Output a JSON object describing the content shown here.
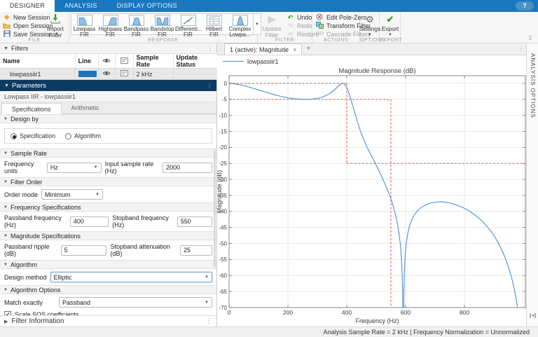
{
  "ribbon": {
    "tabs": [
      {
        "label": "DESIGNER",
        "active": true
      },
      {
        "label": "ANALYSIS",
        "active": false
      },
      {
        "label": "DISPLAY OPTIONS",
        "active": false
      }
    ],
    "help_label": "?",
    "file": {
      "section": "FILE",
      "new": "New Session",
      "open": "Open Session",
      "save": "Save Session",
      "import_line1": "Import",
      "import_line2": "Filter"
    },
    "response": {
      "section": "RESPONSE",
      "items": [
        {
          "line1": "Lowpass",
          "line2": "FIR",
          "icon": "lowpass-fir-icon"
        },
        {
          "line1": "Highpass",
          "line2": "FIR",
          "icon": "highpass-fir-icon"
        },
        {
          "line1": "Bandpass",
          "line2": "FIR",
          "icon": "bandpass-fir-icon"
        },
        {
          "line1": "Bandstop",
          "line2": "FIR",
          "icon": "bandstop-fir-icon"
        },
        {
          "line1": "Differenti...",
          "line2": "FIR",
          "icon": "differentiator-fir-icon"
        },
        {
          "line1": "Hilbert FIR",
          "line2": "",
          "icon": "hilbert-fir-icon"
        },
        {
          "line1": "Complex",
          "line2": "Lowpa...",
          "icon": "complex-lowpass-icon"
        }
      ]
    },
    "filter": {
      "section": "FILTER",
      "update_line1": "Update",
      "update_line2": "Filter",
      "undo": "Undo",
      "redo": "Redo",
      "restore": "Restore"
    },
    "actions": {
      "section": "ACTIONS",
      "items": [
        {
          "label": "Edit Pole-Zero",
          "enabled": true,
          "icon": "pole-zero-icon"
        },
        {
          "label": "Transform Filter",
          "enabled": true,
          "icon": "transform-filter-icon"
        },
        {
          "label": "Cascade Filters",
          "enabled": false,
          "icon": "cascade-filters-icon"
        }
      ]
    },
    "options": {
      "section": "OPTIONS",
      "settings": "Settings"
    },
    "export": {
      "section": "EXPORT",
      "export": "Export"
    }
  },
  "filters_panel": {
    "title": "Filters",
    "columns": [
      "Name",
      "Line",
      "eye",
      "info",
      "Sample Rate",
      "Update Status"
    ],
    "rows": [
      {
        "name": "lowpassiir1",
        "line_color": "#1b75bc",
        "visible": true,
        "sample_rate": "2 kHz",
        "update_status": ""
      }
    ]
  },
  "parameters_panel": {
    "title": "Parameters",
    "subtitle": "Lowpass IIR - lowpassiir1",
    "tabs": [
      {
        "label": "Specifications",
        "active": true
      },
      {
        "label": "Arithmetic",
        "active": false
      }
    ],
    "design_by": {
      "title": "Design by",
      "options": [
        {
          "label": "Specification",
          "selected": true
        },
        {
          "label": "Algorithm",
          "selected": false
        }
      ]
    },
    "sample_rate": {
      "title": "Sample Rate",
      "frequency_units_label": "Frequency units",
      "frequency_units_value": "Hz",
      "input_rate_label": "Input sample rate (Hz)",
      "input_rate_value": "2000"
    },
    "filter_order": {
      "title": "Filter Order",
      "order_mode_label": "Order mode",
      "order_mode_value": "Minimum"
    },
    "frequency_specifications": {
      "title": "Frequency Specifications",
      "passband_label": "Passband frequency (Hz)",
      "passband_value": "400",
      "stopband_label": "Stopband frequency (Hz)",
      "stopband_value": "550"
    },
    "magnitude_specifications": {
      "title": "Magnitude Specifications",
      "ripple_label": "Passband ripple (dB)",
      "ripple_value": "5",
      "attenuation_label": "Stopband attenuation (dB)",
      "attenuation_value": "25"
    },
    "algorithm": {
      "title": "Algorithm",
      "design_method_label": "Design method",
      "design_method_value": "Elliptic"
    },
    "algorithm_options": {
      "title": "Algorithm Options",
      "match_label": "Match exactly",
      "match_value": "Passband",
      "scale_sos_label": "Scale SOS coefficients",
      "scale_sos_checked": true
    },
    "filter_information": {
      "title": "Filter Information"
    }
  },
  "plot_panel": {
    "tab": "1 (active): Magnitude",
    "close": "×",
    "add_tab": "+",
    "legend": "lowpassiir1",
    "analysis_options_label": "ANALYSIS OPTIONS"
  },
  "status_bar": {
    "right": "Analysis Sample Rate = 2 kHz | Frequency Normalization = Unnormalized"
  },
  "chart_data": {
    "type": "line",
    "title": "Magnitude Response (dB)",
    "xlabel": "Frequency (Hz)",
    "ylabel": "Magnitude (dB)",
    "xlim": [
      0,
      1007
    ],
    "ylim": [
      -70,
      2.4
    ],
    "xticks": [
      0,
      200,
      400,
      600,
      800
    ],
    "yticks": [
      0,
      -5,
      -10,
      -15,
      -20,
      -25,
      -30,
      -35,
      -40,
      -45,
      -50,
      -55,
      -60,
      -65,
      -70
    ],
    "grid": true,
    "legend_entries": [
      "lowpassiir1"
    ],
    "line_color": "#4a90d2",
    "mask_color": "#f2695f",
    "series": [
      {
        "name": "lowpassiir1",
        "points": [
          [
            0,
            0
          ],
          [
            25,
            -0.25
          ],
          [
            50,
            -0.7
          ],
          [
            75,
            -1.35
          ],
          [
            100,
            -2.05
          ],
          [
            125,
            -2.75
          ],
          [
            150,
            -3.45
          ],
          [
            175,
            -4.05
          ],
          [
            200,
            -4.55
          ],
          [
            225,
            -4.85
          ],
          [
            250,
            -5.0
          ],
          [
            275,
            -4.97
          ],
          [
            300,
            -4.7
          ],
          [
            315,
            -4.35
          ],
          [
            330,
            -3.8
          ],
          [
            345,
            -3.0
          ],
          [
            358,
            -2.05
          ],
          [
            368,
            -1.15
          ],
          [
            376,
            -0.45
          ],
          [
            382,
            -0.12
          ],
          [
            386,
            -0.03
          ],
          [
            390,
            -0.12
          ],
          [
            394,
            -0.45
          ],
          [
            398,
            -1.0
          ],
          [
            403,
            -2.0
          ],
          [
            408,
            -3.3
          ],
          [
            414,
            -5.0
          ],
          [
            420,
            -6.9
          ],
          [
            428,
            -9.4
          ],
          [
            436,
            -11.9
          ],
          [
            446,
            -14.7
          ],
          [
            458,
            -17.6
          ],
          [
            470,
            -20.1
          ],
          [
            482,
            -22.3
          ],
          [
            495,
            -24.6
          ],
          [
            508,
            -27.0
          ],
          [
            520,
            -29.4
          ],
          [
            532,
            -31.9
          ],
          [
            543,
            -34.3
          ],
          [
            552,
            -36.6
          ],
          [
            560,
            -39.0
          ],
          [
            567,
            -41.6
          ],
          [
            573,
            -44.3
          ],
          [
            578,
            -47.2
          ],
          [
            582,
            -50.2
          ],
          [
            585,
            -53.5
          ],
          [
            587,
            -57
          ],
          [
            589,
            -62
          ],
          [
            590,
            -66
          ],
          [
            591,
            -78
          ],
          [
            593,
            -78
          ],
          [
            594,
            -66
          ],
          [
            596,
            -58
          ],
          [
            599,
            -53
          ],
          [
            603,
            -49.3
          ],
          [
            608,
            -46.5
          ],
          [
            614,
            -44.3
          ],
          [
            621,
            -42.5
          ],
          [
            630,
            -41.0
          ],
          [
            640,
            -39.8
          ],
          [
            652,
            -38.8
          ],
          [
            665,
            -38.1
          ],
          [
            680,
            -37.5
          ],
          [
            695,
            -37.2
          ],
          [
            710,
            -37.0
          ],
          [
            725,
            -37.0
          ],
          [
            740,
            -37.2
          ],
          [
            755,
            -37.5
          ],
          [
            770,
            -37.9
          ],
          [
            785,
            -38.4
          ],
          [
            800,
            -39.0
          ],
          [
            815,
            -39.8
          ],
          [
            830,
            -40.7
          ],
          [
            845,
            -41.8
          ],
          [
            860,
            -43.0
          ],
          [
            875,
            -44.5
          ],
          [
            890,
            -46.2
          ],
          [
            905,
            -48.2
          ],
          [
            920,
            -50.7
          ],
          [
            935,
            -53.7
          ],
          [
            948,
            -57
          ],
          [
            960,
            -60.5
          ],
          [
            970,
            -64.5
          ],
          [
            978,
            -68.5
          ],
          [
            984,
            -73
          ],
          [
            987,
            -78
          ]
        ]
      }
    ],
    "mask_segments": [
      [
        [
          0,
          0
        ],
        [
          400,
          0
        ]
      ],
      [
        [
          400,
          0
        ],
        [
          400,
          -25
        ]
      ],
      [
        [
          400,
          -25
        ],
        [
          1007,
          -25
        ]
      ],
      [
        [
          0,
          -5
        ],
        [
          550,
          -5
        ]
      ],
      [
        [
          550,
          -5
        ],
        [
          550,
          -70
        ]
      ]
    ]
  }
}
